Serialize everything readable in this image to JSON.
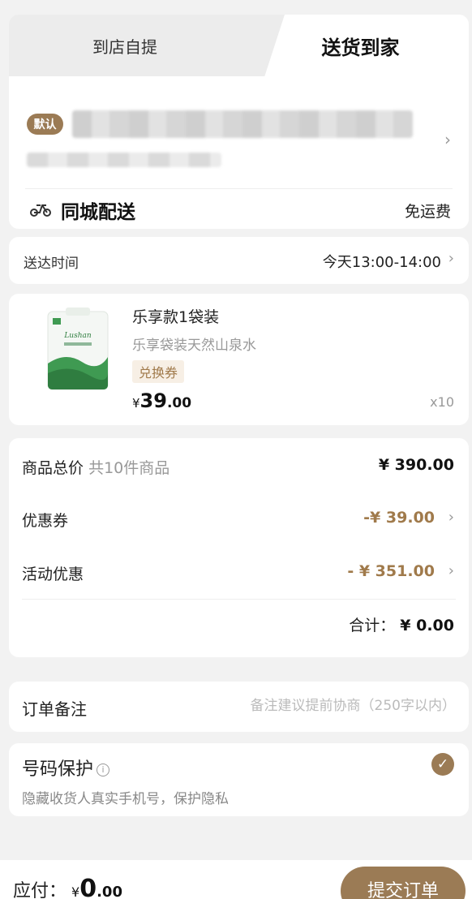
{
  "tabs": {
    "pickup": "到店自提",
    "delivery": "送货到家"
  },
  "address": {
    "default_badge": "默认"
  },
  "delivery": {
    "label": "同城配送",
    "fee": "免运费"
  },
  "time": {
    "label": "送达时间",
    "value": "今天13:00-14:00"
  },
  "product": {
    "name": "乐享款1袋装",
    "desc": "乐享袋装天然山泉水",
    "tag": "兑换券",
    "currency": "¥",
    "price_int": "39",
    "price_dec": ".00",
    "qty": "x10"
  },
  "summary": {
    "goods_label": "商品总价",
    "goods_count": "共10件商品",
    "goods_value": "¥ 390.00",
    "coupon_label": "优惠券",
    "coupon_value": "-¥ 39.00",
    "activity_label": "活动优惠",
    "activity_value": "- ¥ 351.00",
    "total_label": "合计：",
    "total_value": "¥ 0.00"
  },
  "remark": {
    "label": "订单备注",
    "placeholder": "备注建议提前协商（250字以内）"
  },
  "privacy": {
    "title": "号码保护",
    "info": "i",
    "desc": "隐藏收货人真实手机号，保护隐私",
    "checked": true
  },
  "bottom": {
    "pay_label": "应付：",
    "currency": "¥",
    "amount_int": "0",
    "amount_dec": ".00",
    "submit": "提交订单"
  },
  "icons": {
    "chevron": "›",
    "check": "✓"
  }
}
